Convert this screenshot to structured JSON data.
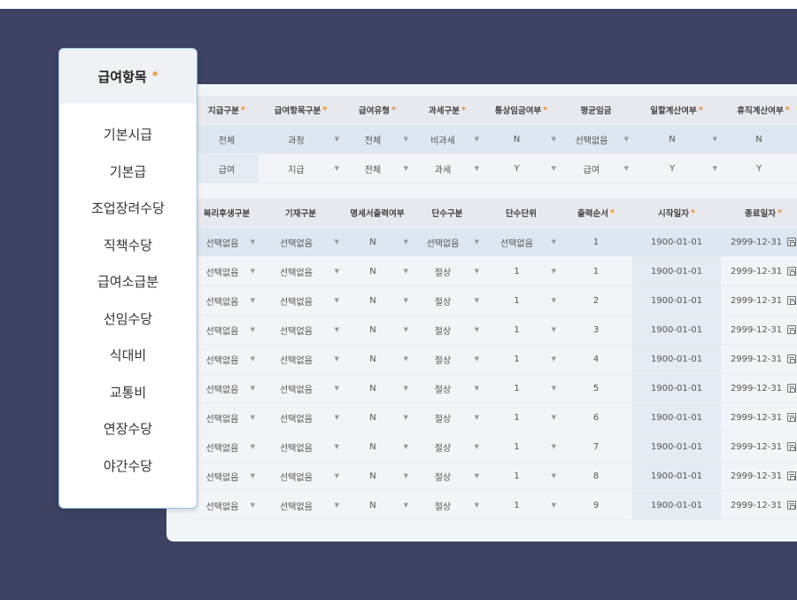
{
  "sidebar": {
    "title": "급여항목",
    "title_marker": "*",
    "items": [
      "기본시급",
      "기본급",
      "조업장려수당",
      "직책수당",
      "급여소급분",
      "선임수당",
      "식대비",
      "교통비",
      "연장수당",
      "야간수당"
    ]
  },
  "table1": {
    "headers": [
      {
        "label": "지급구분",
        "required": true
      },
      {
        "label": "급여항목구분",
        "required": true
      },
      {
        "label": "급여유형",
        "required": true
      },
      {
        "label": "과세구분",
        "required": true
      },
      {
        "label": "통상임금여부",
        "required": true
      },
      {
        "label": "평균임금",
        "required": false
      },
      {
        "label": "일할계산여부",
        "required": true
      },
      {
        "label": "휴직계산여부",
        "required": true
      }
    ],
    "rows": [
      [
        "전체",
        "과정",
        "전체",
        "비과세",
        "N",
        "선택없음",
        "N",
        "N"
      ],
      [
        "급여",
        "지급",
        "전체",
        "과세",
        "Y",
        "급여",
        "Y",
        "Y"
      ]
    ]
  },
  "table2": {
    "headers": [
      {
        "label": "복리후생구분",
        "required": false
      },
      {
        "label": "기재구분",
        "required": false
      },
      {
        "label": "명세서출력여부",
        "required": false
      },
      {
        "label": "단수구분",
        "required": false
      },
      {
        "label": "단수단위",
        "required": false
      },
      {
        "label": "출력순서",
        "required": true
      },
      {
        "label": "시작일자",
        "required": true
      },
      {
        "label": "종료일자",
        "required": true
      }
    ],
    "rows": [
      [
        "선택없음",
        "선택없음",
        "N",
        "선택없음",
        "선택없음",
        "1",
        "1900-01-01",
        "2999-12-31"
      ],
      [
        "선택없음",
        "선택없음",
        "N",
        "절상",
        "1",
        "1",
        "1900-01-01",
        "2999-12-31"
      ],
      [
        "선택없음",
        "선택없음",
        "N",
        "절상",
        "1",
        "2",
        "1900-01-01",
        "2999-12-31"
      ],
      [
        "선택없음",
        "선택없음",
        "N",
        "절상",
        "1",
        "3",
        "1900-01-01",
        "2999-12-31"
      ],
      [
        "선택없음",
        "선택없음",
        "N",
        "절상",
        "1",
        "4",
        "1900-01-01",
        "2999-12-31"
      ],
      [
        "선택없음",
        "선택없음",
        "N",
        "절상",
        "1",
        "5",
        "1900-01-01",
        "2999-12-31"
      ],
      [
        "선택없음",
        "선택없음",
        "N",
        "절상",
        "1",
        "6",
        "1900-01-01",
        "2999-12-31"
      ],
      [
        "선택없음",
        "선택없음",
        "N",
        "절상",
        "1",
        "7",
        "1900-01-01",
        "2999-12-31"
      ],
      [
        "선택없음",
        "선택없음",
        "N",
        "절상",
        "1",
        "8",
        "1900-01-01",
        "2999-12-31"
      ],
      [
        "선택없음",
        "선택없음",
        "N",
        "절상",
        "1",
        "9",
        "1900-01-01",
        "2999-12-31"
      ]
    ]
  },
  "icons": {
    "dropdown": "chevron-down-icon",
    "date": "calendar-icon"
  },
  "colors": {
    "background": "#3d4262",
    "required": "#f08a24",
    "sidebar_border": "#8fc3e6",
    "selected_row": "#dde7f1"
  }
}
